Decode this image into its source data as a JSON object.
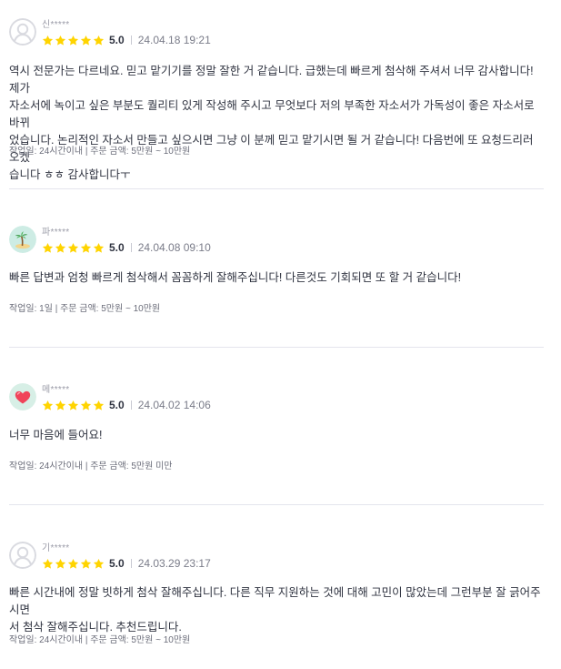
{
  "reviews": [
    {
      "name": "신*****",
      "avatar": "default-profile-icon",
      "score": "5.0",
      "date": "24.04.18 19:21",
      "content": "역시 전문가는 다르네요. 믿고 맡기기를 정말 잘한 거 같습니다. 급했는데 빠르게 첨삭해 주셔서 너무 감사합니다! 제가\n자소서에 녹이고 싶은 부분도 퀄리티 있게 작성해 주시고 무엇보다 저의 부족한 자소서가 가독성이 좋은 자소서로 바뀌\n었습니다. 논리적인 자소서 만들고 싶으시면 그냥 이 분께 믿고 맡기시면 될 거 같습니다! 다음번에 또 요청드리러 오겠\n습니다 ㅎㅎ 감사합니다ㅜ",
      "meta": "작업일: 24시간이내 | 주문 금액: 5만원 ~ 10만원"
    },
    {
      "name": "파*****",
      "avatar": "palm-island-icon",
      "score": "5.0",
      "date": "24.04.08 09:10",
      "content": "빠른 답변과 엄청 빠르게 첨삭해서 꼼꼼하게 잘해주십니다! 다른것도 기회되면 또 할 거 같습니다!",
      "meta": "작업일: 1일 | 주문 금액: 5만원 ~ 10만원"
    },
    {
      "name": "메*****",
      "avatar": "red-heart-icon",
      "score": "5.0",
      "date": "24.04.02 14:06",
      "content": "너무 마음에 들어요!",
      "meta": "작업일: 24시간이내 | 주문 금액: 5만원 미만"
    },
    {
      "name": "기*****",
      "avatar": "default-profile-icon",
      "score": "5.0",
      "date": "24.03.29 23:17",
      "content": "빠른 시간내에 정말 빗하게 첨삭 잘해주십니다. 다른 직무 지원하는 것에 대해 고민이 많았는데 그런부분 잘 긁어주시면\n서 첨삭 잘해주십니다. 추천드립니다.",
      "meta": "작업일: 24시간이내 | 주문 금액: 5만원 ~ 10만원"
    }
  ],
  "colors": {
    "star": "#ffd400",
    "text": "#303441",
    "muted": "#9a9ba7",
    "divider": "#e4e5ed"
  }
}
